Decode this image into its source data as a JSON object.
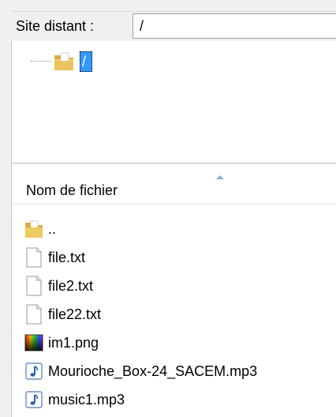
{
  "remote_site": {
    "label": "Site distant :",
    "path": "/"
  },
  "tree": {
    "root": {
      "label": "/",
      "icon": "folder-icon"
    }
  },
  "file_list": {
    "column_header": "Nom de fichier",
    "sort": "ascending",
    "files": [
      {
        "name": "..",
        "icon": "folder-icon"
      },
      {
        "name": "file.txt",
        "icon": "text-file-icon"
      },
      {
        "name": "file2.txt",
        "icon": "text-file-icon"
      },
      {
        "name": "file22.txt",
        "icon": "text-file-icon"
      },
      {
        "name": "im1.png",
        "icon": "image-file-icon"
      },
      {
        "name": "Mourioche_Box-24_SACEM.mp3",
        "icon": "audio-file-icon"
      },
      {
        "name": "music1.mp3",
        "icon": "audio-file-icon"
      }
    ]
  },
  "colors": {
    "selection": "#3399ff",
    "folder": "#e8c15a",
    "panel_bg": "#f0f0f0"
  }
}
